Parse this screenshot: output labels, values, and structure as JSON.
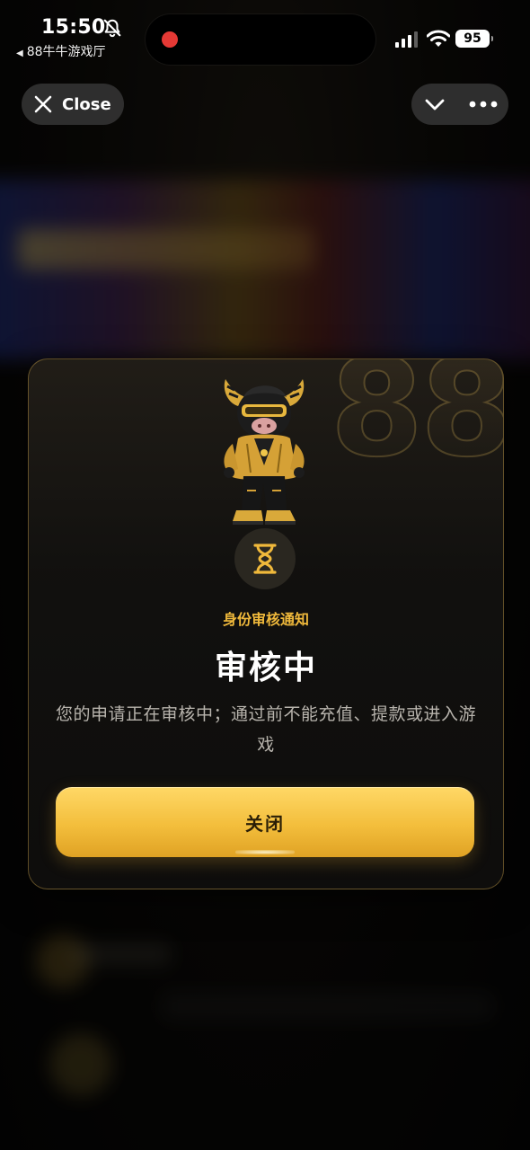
{
  "status_bar": {
    "time": "15:50",
    "back_app": "88牛牛游戏厅",
    "battery": "95"
  },
  "top_controls": {
    "close_label": "Close"
  },
  "modal": {
    "decor_number": "88",
    "subtitle": "身份审核通知",
    "headline": "审核中",
    "message": "您的申请正在审核中；通过前不能充值、提款或进入游戏",
    "button_label": "关闭"
  },
  "colors": {
    "accent_gold": "#f0b93b",
    "button_gold_top": "#ffd866",
    "button_gold_bottom": "#e0a224",
    "record_red": "#e53935"
  },
  "icons": [
    "bell-slash-icon",
    "back-triangle-icon",
    "record-indicator-icon",
    "signal-icon",
    "wifi-icon",
    "battery-icon",
    "close-x-icon",
    "chevron-down-icon",
    "more-dots-icon",
    "hourglass-icon"
  ]
}
